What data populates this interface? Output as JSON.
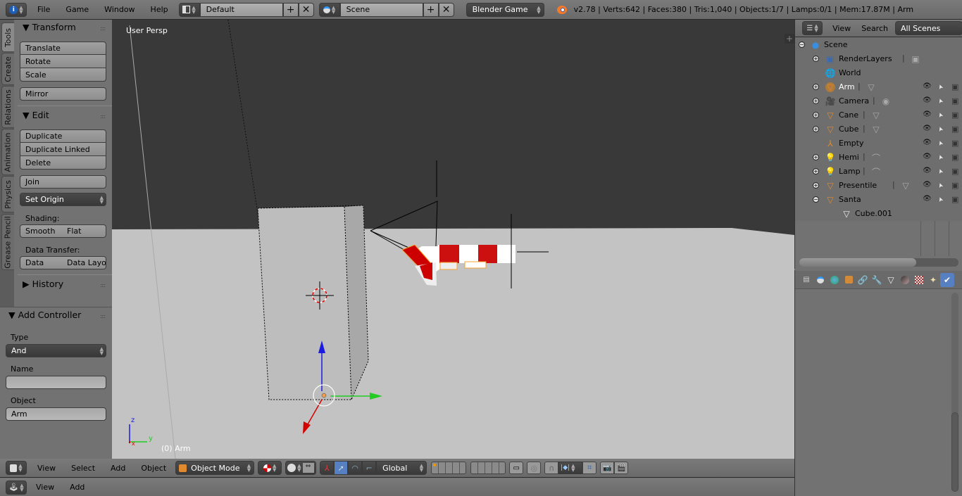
{
  "topbar": {
    "menus": [
      "File",
      "Game",
      "Window",
      "Help"
    ],
    "screen_layout": "Default",
    "scene": "Scene",
    "render_engine": "Blender Game",
    "stats": "v2.78 | Verts:642 | Faces:380 | Tris:1,040 | Objects:1/7 | Lamps:0/1 | Mem:17.87M | Arm"
  },
  "toolshelf": {
    "tabs": [
      "Tools",
      "Create",
      "Relations",
      "Animation",
      "Physics",
      "Grease Pencil"
    ],
    "active_tab": "Tools",
    "transform": {
      "title": "Transform",
      "buttons": [
        "Translate",
        "Rotate",
        "Scale",
        "Mirror"
      ]
    },
    "edit": {
      "title": "Edit",
      "buttons": [
        "Duplicate",
        "Duplicate Linked",
        "Delete",
        "Join"
      ],
      "set_origin": "Set Origin",
      "shading_label": "Shading:",
      "shading_buttons": [
        "Smooth",
        "Flat"
      ],
      "data_transfer_label": "Data Transfer:",
      "data_transfer_buttons": [
        "Data",
        "Data Layo"
      ]
    },
    "history": {
      "title": "History"
    }
  },
  "operator_panel": {
    "title": "Add Controller",
    "type_label": "Type",
    "type_value": "And",
    "name_label": "Name",
    "name_value": "",
    "object_label": "Object",
    "object_value": "Arm"
  },
  "viewport": {
    "view_label": "User Persp",
    "object_label": "(0) Arm",
    "axis_labels": {
      "x": "x",
      "y": "y",
      "z": "z"
    },
    "colors": {
      "floor": "#c3c3c3",
      "sky": "#393939",
      "x_axis": "#d40000",
      "y_axis": "#22cc22",
      "z_axis": "#1a1ae0"
    }
  },
  "viewport_header": {
    "menus": [
      "View",
      "Select",
      "Add",
      "Object"
    ],
    "mode": "Object Mode",
    "orientation": "Global"
  },
  "logic_header": {
    "menus": [
      "View",
      "Add"
    ]
  },
  "outliner": {
    "menus": [
      "View",
      "Search"
    ],
    "display_mode": "All Scenes",
    "items": [
      {
        "name": "Scene",
        "icon": "scene-icon",
        "level": 0,
        "expand": "minus"
      },
      {
        "name": "RenderLayers",
        "icon": "render-layers-icon",
        "level": 1,
        "expand": "plus",
        "data_icon": "render-layer-icon"
      },
      {
        "name": "World",
        "icon": "world-icon",
        "level": 1,
        "expand": ""
      },
      {
        "name": "Arm",
        "icon": "mesh-object-icon",
        "level": 1,
        "expand": "plus",
        "data_icon": "mesh-data-icon",
        "selected": true,
        "vis": true
      },
      {
        "name": "Camera",
        "icon": "camera-icon",
        "level": 1,
        "expand": "plus",
        "data_icon": "camera-data-icon",
        "vis": true
      },
      {
        "name": "Cane",
        "icon": "mesh-object-icon",
        "level": 1,
        "expand": "plus",
        "data_icon": "mesh-data-icon",
        "vis": true
      },
      {
        "name": "Cube",
        "icon": "mesh-object-icon",
        "level": 1,
        "expand": "plus",
        "data_icon": "mesh-data-icon",
        "vis": true
      },
      {
        "name": "Empty",
        "icon": "empty-icon",
        "level": 1,
        "expand": "",
        "vis": true
      },
      {
        "name": "Hemi",
        "icon": "lamp-icon",
        "level": 1,
        "expand": "plus",
        "data_icon": "lamp-data-icon",
        "vis": true
      },
      {
        "name": "Lamp",
        "icon": "lamp-icon",
        "level": 1,
        "expand": "plus",
        "data_icon": "lamp-data-icon",
        "vis": true
      },
      {
        "name": "Presentile",
        "icon": "mesh-object-icon",
        "level": 1,
        "expand": "plus",
        "data_icon": "mesh-data-icon",
        "vis": true
      },
      {
        "name": "Santa",
        "icon": "mesh-object-icon",
        "level": 1,
        "expand": "minus",
        "vis": true
      },
      {
        "name": "Cube.001",
        "icon": "mesh-data-icon",
        "level": 2,
        "expand": ""
      }
    ]
  },
  "properties": {
    "tabs": [
      "render-layers",
      "scene",
      "world",
      "object",
      "constraints",
      "modifiers",
      "data",
      "material",
      "texture",
      "particles",
      "physics"
    ],
    "active_tab": "physics"
  }
}
